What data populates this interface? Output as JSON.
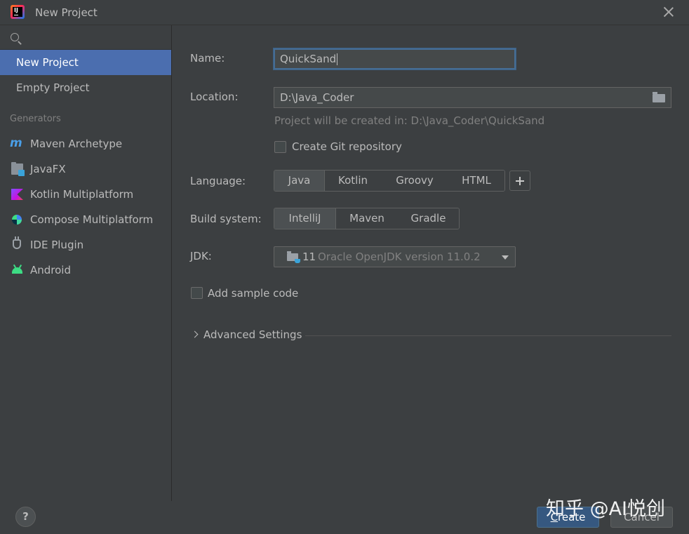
{
  "window": {
    "title": "New Project"
  },
  "sidebar": {
    "search": {
      "placeholder": ""
    },
    "project_types": [
      {
        "label": "New Project",
        "selected": true
      },
      {
        "label": "Empty Project",
        "selected": false
      }
    ],
    "generators_header": "Generators",
    "generators": [
      {
        "label": "Maven Archetype",
        "icon": "maven-icon"
      },
      {
        "label": "JavaFX",
        "icon": "javafx-icon"
      },
      {
        "label": "Kotlin Multiplatform",
        "icon": "kotlin-icon"
      },
      {
        "label": "Compose Multiplatform",
        "icon": "compose-icon"
      },
      {
        "label": "IDE Plugin",
        "icon": "plugin-icon"
      },
      {
        "label": "Android",
        "icon": "android-icon"
      }
    ]
  },
  "form": {
    "name": {
      "label": "Name:",
      "value": "QuickSand"
    },
    "location": {
      "label": "Location:",
      "value": "D:\\Java_Coder",
      "hint": "Project will be created in: D:\\Java_Coder\\QuickSand"
    },
    "git": {
      "label": "Create Git repository",
      "checked": false
    },
    "language": {
      "label": "Language:",
      "options": [
        "Java",
        "Kotlin",
        "Groovy",
        "HTML"
      ],
      "selected": "Java"
    },
    "build_system": {
      "label": "Build system:",
      "options": [
        "IntelliJ",
        "Maven",
        "Gradle"
      ],
      "selected": "IntelliJ"
    },
    "jdk": {
      "label": "JDK:",
      "version": "11",
      "description": "Oracle OpenJDK version 11.0.2"
    },
    "sample_code": {
      "label": "Add sample code",
      "checked": false
    },
    "advanced": {
      "label": "Advanced Settings"
    }
  },
  "footer": {
    "help_label": "?",
    "create_mnemonic": "C",
    "create_rest": "reate",
    "cancel_label": "Cancel"
  },
  "watermark": "知乎 @AI悦创",
  "colors": {
    "background": "#3c3f41",
    "selection": "#4b6eaf",
    "primary_button": "#365880",
    "focus_border": "#466d94"
  }
}
